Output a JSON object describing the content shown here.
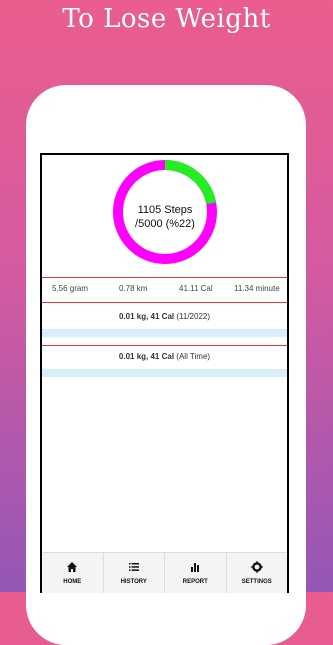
{
  "promo": {
    "title": "To Lose Weight"
  },
  "progress": {
    "steps_line": "1105 Steps",
    "goal_line": "/5000 (%22)",
    "fraction": 0.22,
    "colors": {
      "done": "#22ee22",
      "remaining": "#ff00ff"
    }
  },
  "stats": {
    "gram": "5.56  gram",
    "km": "0.78 km",
    "cal": "41.11 Cal",
    "minute": "11.34 minute"
  },
  "summaries": {
    "month": {
      "value": "0.01  kg, 41 Cal",
      "period": "(11/2022)"
    },
    "all_time": {
      "value": "0.01  kg, 41 Cal",
      "period": "(All Time)"
    }
  },
  "nav": {
    "home": "HOME",
    "history": "HISTORY",
    "report": "REPORT",
    "settings": "SETTINGS"
  },
  "icons": [
    "home-icon",
    "list-icon",
    "bar-chart-icon",
    "gear-icon"
  ]
}
